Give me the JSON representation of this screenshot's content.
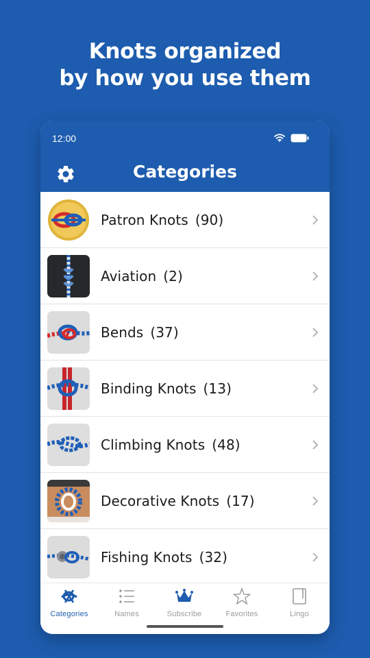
{
  "promo": {
    "headline_line1": "Knots organized",
    "headline_line2": "by how you use them"
  },
  "status_bar": {
    "time": "12:00"
  },
  "app_bar": {
    "title": "Categories",
    "settings_icon": "gear-icon"
  },
  "categories": [
    {
      "name": "Patron Knots",
      "count": "(90)",
      "thumb": "patron-logo"
    },
    {
      "name": "Aviation",
      "count": "(2)",
      "thumb": "aviation-knot"
    },
    {
      "name": "Bends",
      "count": "(37)",
      "thumb": "bends-knot"
    },
    {
      "name": "Binding Knots",
      "count": "(13)",
      "thumb": "binding-knot"
    },
    {
      "name": "Climbing Knots",
      "count": "(48)",
      "thumb": "climbing-knot"
    },
    {
      "name": "Decorative Knots",
      "count": "(17)",
      "thumb": "decorative-knot"
    },
    {
      "name": "Fishing Knots",
      "count": "(32)",
      "thumb": "fishing-knot"
    }
  ],
  "tabs": [
    {
      "label": "Categories",
      "icon": "knot-icon",
      "active": true
    },
    {
      "label": "Names",
      "icon": "list-icon",
      "active": false
    },
    {
      "label": "Subscribe",
      "icon": "crown-icon",
      "active": false
    },
    {
      "label": "Favorites",
      "icon": "star-icon",
      "active": false
    },
    {
      "label": "Lingo",
      "icon": "book-icon",
      "active": false
    }
  ],
  "colors": {
    "brand_blue": "#1d5cae",
    "tab_inactive": "#9a9a9a",
    "rope_blue": "#1f5fb8",
    "rope_red": "#d62a2a",
    "patron_gold": "#e0b43a"
  }
}
